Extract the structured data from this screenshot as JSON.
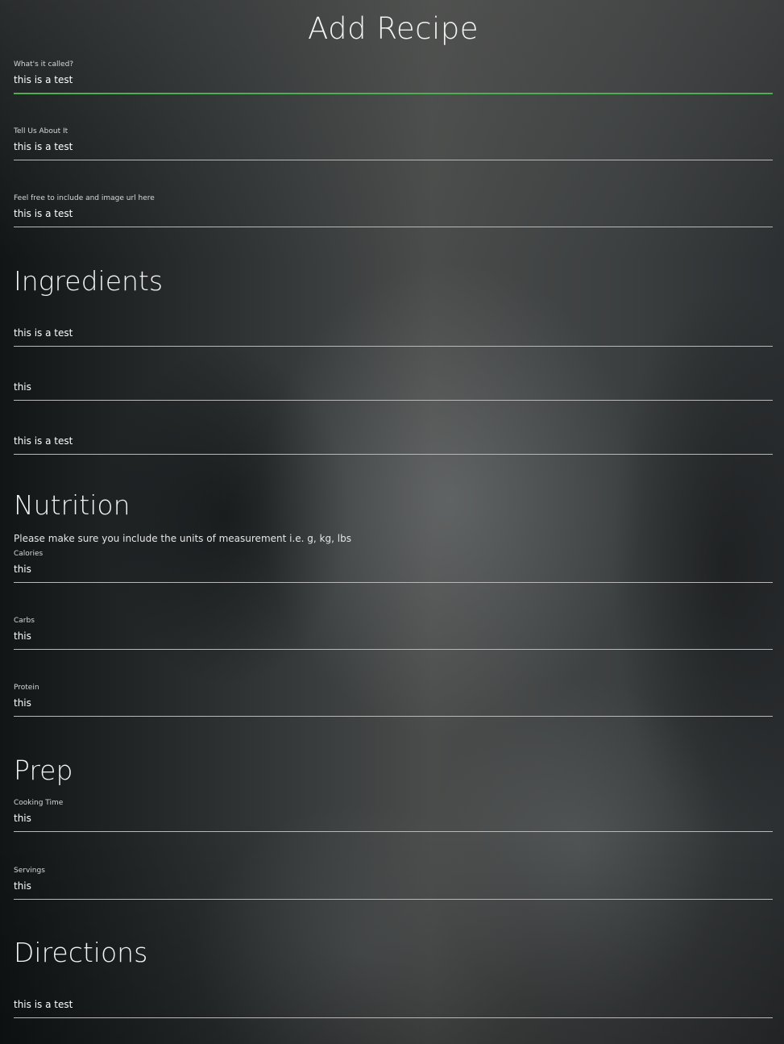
{
  "header": {
    "title": "Add Recipe"
  },
  "basics": {
    "name": {
      "label": "What's it called?",
      "value": "this is a test"
    },
    "description": {
      "label": "Tell Us About It",
      "value": "this is a test"
    },
    "image_url": {
      "label": "Feel free to include and image url here",
      "value": "this is a test"
    }
  },
  "ingredients": {
    "heading": "Ingredients",
    "items": [
      "this is a test",
      "this",
      "this is a test"
    ]
  },
  "nutrition": {
    "heading": "Nutrition",
    "note": "Please make sure you include the units of measurement i.e. g, kg, lbs",
    "calories": {
      "label": "Calories",
      "value": "this"
    },
    "carbs": {
      "label": "Carbs",
      "value": "this"
    },
    "protein": {
      "label": "Protein",
      "value": "this"
    }
  },
  "prep": {
    "heading": "Prep",
    "cooking_time": {
      "label": "Cooking Time",
      "value": "this"
    },
    "servings": {
      "label": "Servings",
      "value": "this"
    }
  },
  "directions": {
    "heading": "Directions",
    "items": [
      "this is a test"
    ]
  },
  "colors": {
    "focus_underline": "#4caf50",
    "underline": "#b9b9b9",
    "text": "#ffffff"
  }
}
